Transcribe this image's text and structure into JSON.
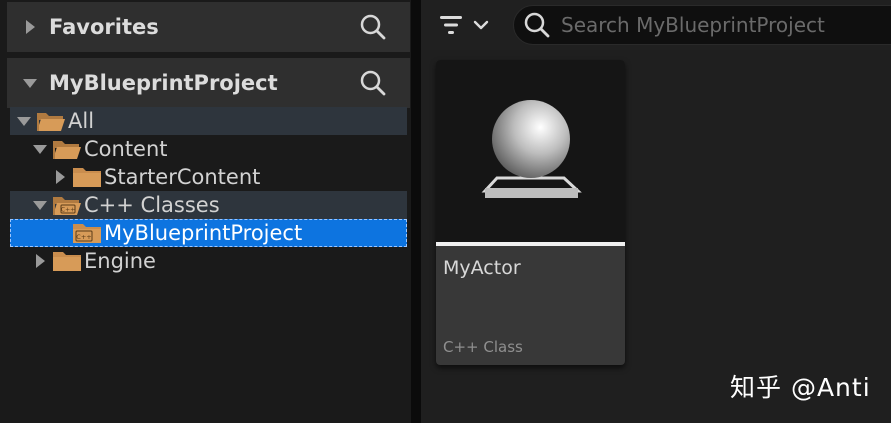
{
  "sources": {
    "favorites_label": "Favorites",
    "project_label": "MyBlueprintProject",
    "tree": [
      {
        "label": "All"
      },
      {
        "label": "Content"
      },
      {
        "label": "StarterContent"
      },
      {
        "label": "C++ Classes"
      },
      {
        "label": "MyBlueprintProject"
      },
      {
        "label": "Engine"
      }
    ]
  },
  "toolbar": {
    "search_placeholder": "Search MyBlueprintProject"
  },
  "assets": [
    {
      "name": "MyActor",
      "type": "C++ Class",
      "icon": "actor-sphere-icon"
    }
  ],
  "watermark": "知乎 @Anti",
  "colors": {
    "selection": "#0d74e0",
    "folder": "#c98d4e",
    "highlight_row": "#2e353d"
  }
}
